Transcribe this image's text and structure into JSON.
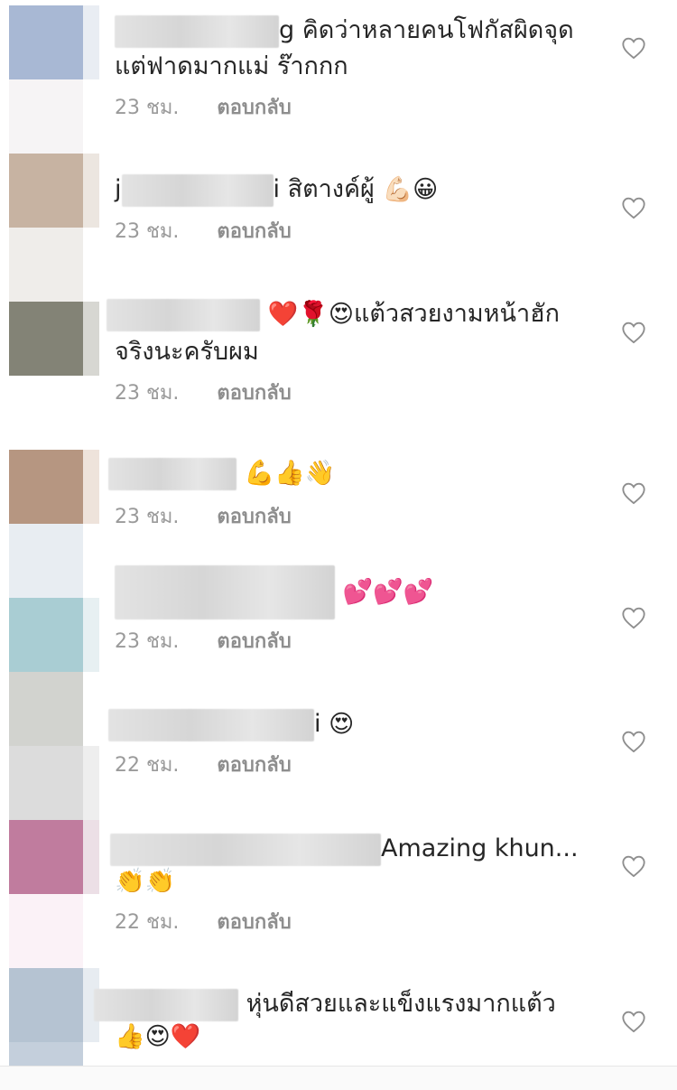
{
  "comments": [
    {
      "handle_tail": "g",
      "line1": "คิดว่าหลายคนโฟกัสผิดจุด",
      "line2": "แต่ฟาดมากแม่ ร๊ากกก",
      "time": "23 ชม.",
      "reply": "ตอบกลับ"
    },
    {
      "handle_head": "j",
      "handle_tail": "i",
      "line1": "สิตางค์ผู้",
      "emojis": "💪🏻😀",
      "time": "23 ชม.",
      "reply": "ตอบกลับ"
    },
    {
      "emojis": "❤️🌹😍",
      "line1": "แต้วสวยงามหน้าฮัก",
      "line2": "จริงนะครับผม",
      "time": "23 ชม.",
      "reply": "ตอบกลับ"
    },
    {
      "emojis": "💪👍👋",
      "time": "23 ชม.",
      "reply": "ตอบกลับ"
    },
    {
      "emojis": "💕💕💕",
      "time": "23 ชม.",
      "reply": "ตอบกลับ"
    },
    {
      "handle_tail": "i",
      "emojis": "😍",
      "time": "22 ชม.",
      "reply": "ตอบกลับ"
    },
    {
      "line1": "Amazing khun...",
      "emojis_line2": "👏👏",
      "time": "22 ชม.",
      "reply": "ตอบกลับ"
    },
    {
      "line1": "หุ่นดีสวยและแข็งแรงมากแต้ว",
      "emojis_line2": "👍😍❤️"
    }
  ],
  "colors": {
    "text": "#262626",
    "meta": "#9a9a9a",
    "heart_outline": "#8e8e8e"
  },
  "icons": {
    "like": "heart-outline-icon"
  }
}
